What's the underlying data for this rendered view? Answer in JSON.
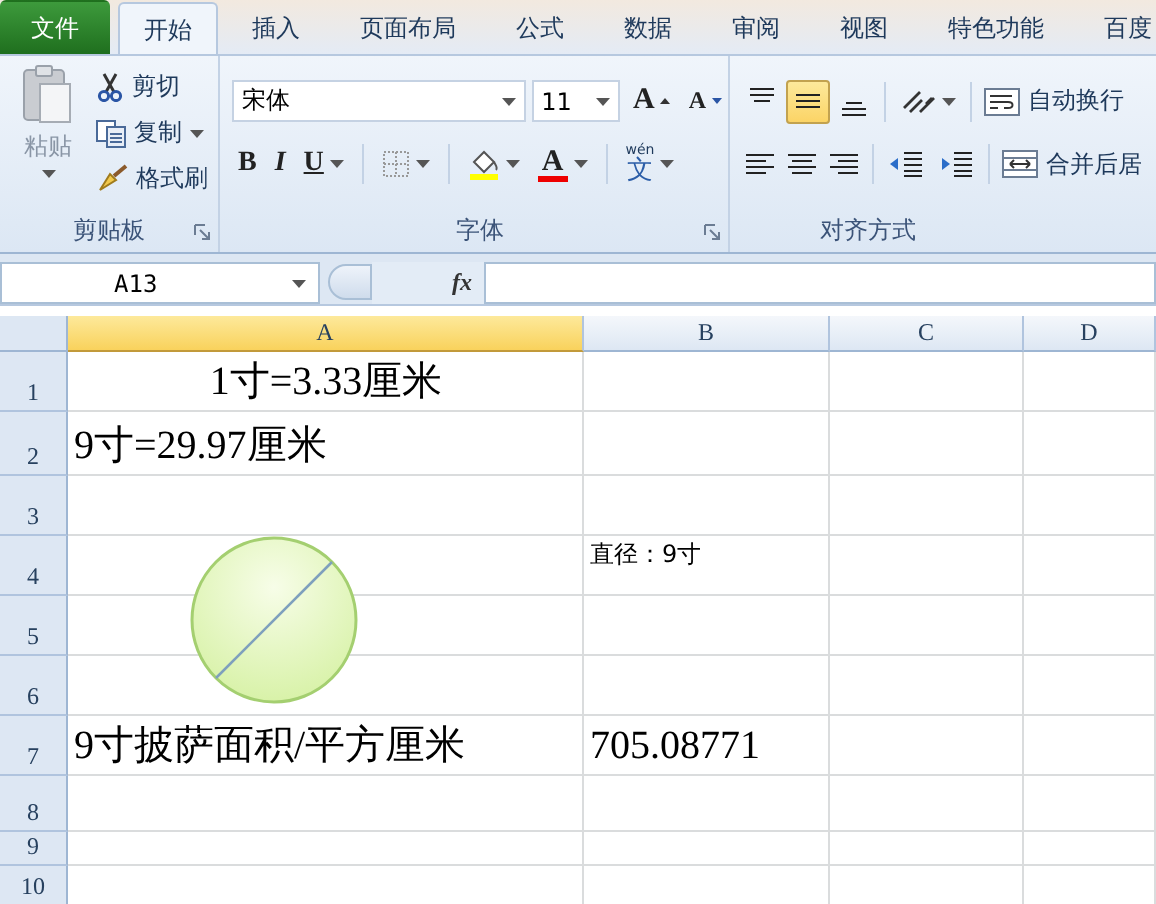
{
  "tabs": [
    {
      "label": "文件",
      "kind": "file",
      "selected": false
    },
    {
      "label": "开始",
      "kind": "tab",
      "selected": true
    },
    {
      "label": "插入",
      "kind": "tab",
      "selected": false
    },
    {
      "label": "页面布局",
      "kind": "tab",
      "selected": false
    },
    {
      "label": "公式",
      "kind": "tab",
      "selected": false
    },
    {
      "label": "数据",
      "kind": "tab",
      "selected": false
    },
    {
      "label": "审阅",
      "kind": "tab",
      "selected": false
    },
    {
      "label": "视图",
      "kind": "tab",
      "selected": false
    },
    {
      "label": "特色功能",
      "kind": "tab",
      "selected": false
    },
    {
      "label": "百度",
      "kind": "tab",
      "selected": false
    }
  ],
  "ribbon": {
    "clipboard": {
      "paste": "粘贴",
      "cut": "剪切",
      "copy": "复制",
      "format_painter": "格式刷",
      "label": "剪贴板"
    },
    "font": {
      "font_name": "宋体",
      "font_size": "11",
      "grow": "A",
      "shrink": "A",
      "bold": "B",
      "italic": "I",
      "underline": "U",
      "font_color": "A",
      "phonetic_top": "wén",
      "phonetic_char": "文",
      "label": "字体"
    },
    "alignment": {
      "vertical": [
        {
          "kind": "top",
          "selected": false
        },
        {
          "kind": "middle",
          "selected": true
        },
        {
          "kind": "bottom",
          "selected": false
        }
      ],
      "wrap_text": "自动换行",
      "merge": "合并后居",
      "label": "对齐方式"
    }
  },
  "formula_bar": {
    "name_box": "A13",
    "function_label": "fx"
  },
  "sheet": {
    "columns": [
      {
        "label": "A",
        "selected": true
      },
      {
        "label": "B",
        "selected": false
      },
      {
        "label": "C",
        "selected": false
      },
      {
        "label": "D",
        "selected": false
      }
    ],
    "rows": [
      {
        "header": "1",
        "A": {
          "text": "1寸=3.33厘米",
          "kind": "large-centered"
        }
      },
      {
        "header": "2",
        "A": {
          "text": "9寸=29.97厘米",
          "kind": "large"
        }
      },
      {
        "header": "3"
      },
      {
        "header": "4",
        "B": {
          "text": "直径：9寸",
          "kind": "small"
        }
      },
      {
        "header": "5"
      },
      {
        "header": "6"
      },
      {
        "header": "7",
        "A": {
          "text": "9寸披萨面积/平方厘米",
          "kind": "large"
        },
        "B": {
          "text": "705.08771",
          "kind": "large"
        }
      },
      {
        "header": "8"
      },
      {
        "header": "9"
      },
      {
        "header": "10"
      }
    ]
  }
}
